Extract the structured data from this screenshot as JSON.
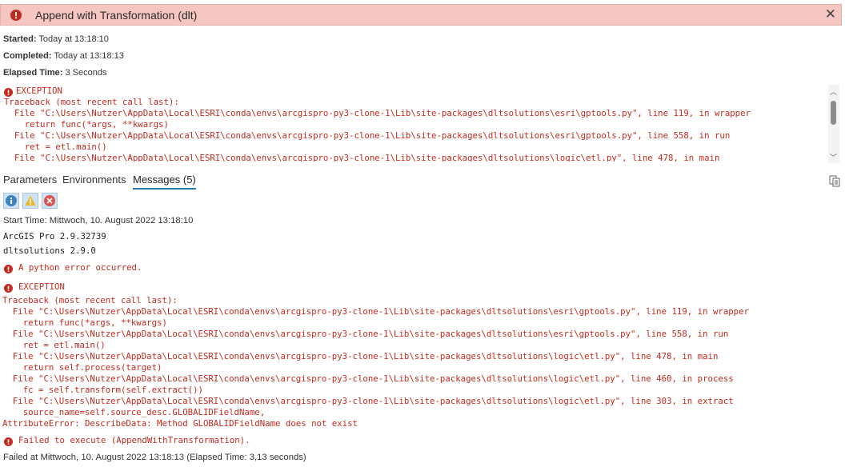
{
  "header": {
    "title": "Append with Transformation (dlt)"
  },
  "meta": {
    "started_label": "Started:",
    "started_value": "Today at 13:18:10",
    "completed_label": "Completed:",
    "completed_value": "Today at 13:18:13",
    "elapsed_label": "Elapsed Time:",
    "elapsed_value": "3 Seconds"
  },
  "summary": {
    "exception_title": "EXCEPTION",
    "lines": [
      "Traceback (most recent call last):",
      "  File \"C:\\Users\\Nutzer\\AppData\\Local\\ESRI\\conda\\envs\\arcgispro-py3-clone-1\\Lib\\site-packages\\dltsolutions\\esri\\gptools.py\", line 119, in wrapper",
      "    return func(*args, **kwargs)",
      "  File \"C:\\Users\\Nutzer\\AppData\\Local\\ESRI\\conda\\envs\\arcgispro-py3-clone-1\\Lib\\site-packages\\dltsolutions\\esri\\gptools.py\", line 558, in run",
      "    ret = etl.main()",
      "  File \"C:\\Users\\Nutzer\\AppData\\Local\\ESRI\\conda\\envs\\arcgispro-py3-clone-1\\Lib\\site-packages\\dltsolutions\\logic\\etl.py\", line 478, in main"
    ]
  },
  "tabs": {
    "parameters": "Parameters",
    "environments": "Environments",
    "messages": "Messages (5)"
  },
  "messages": {
    "start_time": "Start Time: Mittwoch, 10. August 2022 13:18:10",
    "arcgis_version": "ArcGIS Pro 2.9.32739",
    "dlt_version": "dltsolutions 2.9.0",
    "python_error": "A python error occurred.",
    "exception_title": "EXCEPTION",
    "trace_lines": [
      "Traceback (most recent call last):",
      "  File \"C:\\Users\\Nutzer\\AppData\\Local\\ESRI\\conda\\envs\\arcgispro-py3-clone-1\\Lib\\site-packages\\dltsolutions\\esri\\gptools.py\", line 119, in wrapper",
      "    return func(*args, **kwargs)",
      "  File \"C:\\Users\\Nutzer\\AppData\\Local\\ESRI\\conda\\envs\\arcgispro-py3-clone-1\\Lib\\site-packages\\dltsolutions\\esri\\gptools.py\", line 558, in run",
      "    ret = etl.main()",
      "  File \"C:\\Users\\Nutzer\\AppData\\Local\\ESRI\\conda\\envs\\arcgispro-py3-clone-1\\Lib\\site-packages\\dltsolutions\\logic\\etl.py\", line 478, in main",
      "    return self.process(target)",
      "  File \"C:\\Users\\Nutzer\\AppData\\Local\\ESRI\\conda\\envs\\arcgispro-py3-clone-1\\Lib\\site-packages\\dltsolutions\\logic\\etl.py\", line 460, in process",
      "    fc = self.transform(self.extract())",
      "  File \"C:\\Users\\Nutzer\\AppData\\Local\\ESRI\\conda\\envs\\arcgispro-py3-clone-1\\Lib\\site-packages\\dltsolutions\\logic\\etl.py\", line 303, in extract",
      "    source_name=self.source_desc.GLOBALIDFieldName,",
      "AttributeError: DescribeData: Method GLOBALIDFieldName does not exist"
    ],
    "failed_execute": "Failed to execute (AppendWithTransformation).",
    "failed_at": "Failed at Mittwoch, 10. August 2022 13:18:13 (Elapsed Time: 3,13 seconds)"
  },
  "colors": {
    "header_bg": "#f6c6c2",
    "error_red": "#c42a1e",
    "tab_underline": "#2a7ab0"
  }
}
